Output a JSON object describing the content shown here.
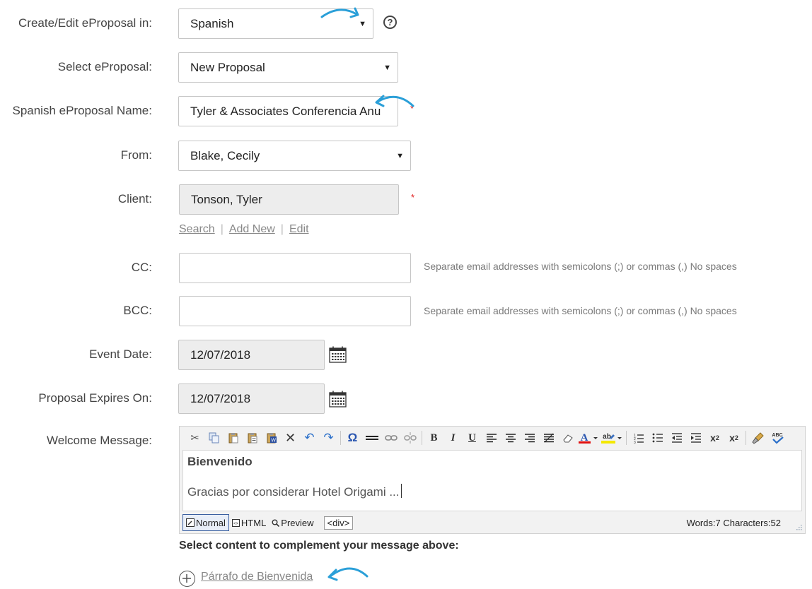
{
  "form": {
    "language": {
      "label": "Create/Edit eProposal in:",
      "value": "Spanish"
    },
    "eproposal": {
      "label": "Select eProposal:",
      "value": "New Proposal"
    },
    "name": {
      "label": "Spanish eProposal Name:",
      "value": "Tyler & Associates Conferencia Anu"
    },
    "from": {
      "label": "From:",
      "value": "Blake, Cecily"
    },
    "client": {
      "label": "Client:",
      "value": "Tonson, Tyler"
    },
    "client_links": {
      "search": "Search",
      "add_new": "Add New",
      "edit": "Edit",
      "sep": "|"
    },
    "cc": {
      "label": "CC:",
      "value": "",
      "hint": "Separate email addresses with semicolons (;) or commas (,) No spaces"
    },
    "bcc": {
      "label": "BCC:",
      "value": "",
      "hint": "Separate email addresses with semicolons (;) or commas (,) No spaces"
    },
    "event_date": {
      "label": "Event Date:",
      "value": "12/07/2018"
    },
    "expires": {
      "label": "Proposal Expires On:",
      "value": "12/07/2018"
    },
    "welcome": {
      "label": "Welcome Message:"
    },
    "required_mark": "*"
  },
  "editor": {
    "heading": "Bienvenido",
    "body": "Gracias por considerar Hotel Origami ...",
    "modes": {
      "normal": "Normal",
      "html": "HTML",
      "preview": "Preview"
    },
    "tag": "<div>",
    "word_count": "Words:7 Characters:52"
  },
  "complement": {
    "title": "Select content to complement your message above:",
    "link": "Párrafo de Bienvenida"
  },
  "colors": {
    "accent_arrow": "#2a9fd8",
    "required": "#e02020"
  }
}
